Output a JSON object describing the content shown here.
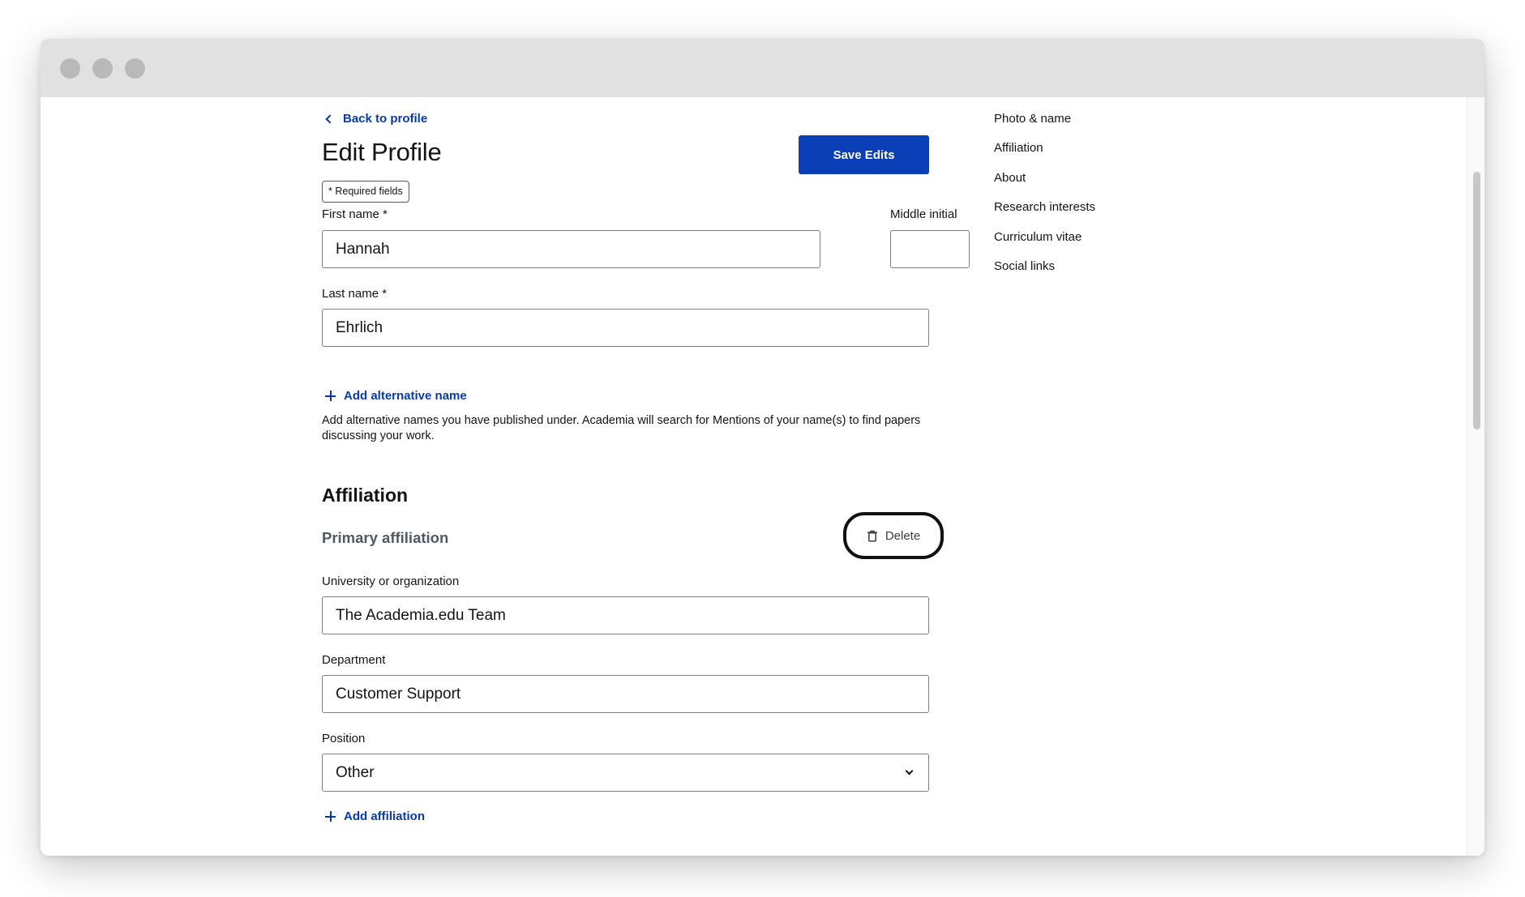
{
  "back_link": {
    "label": "Back to profile"
  },
  "page": {
    "title": "Edit Profile",
    "save_label": "Save Edits",
    "required_note": "* Required fields"
  },
  "name_fields": {
    "first_name": {
      "label": "First name *",
      "value": "Hannah"
    },
    "middle_initial": {
      "label": "Middle initial",
      "value": ""
    },
    "last_name": {
      "label": "Last name *",
      "value": "Ehrlich"
    }
  },
  "alternative_name": {
    "add_label": "Add alternative name",
    "help_text": "Add alternative names you have published under. Academia will search for Mentions of your name(s) to find papers discussing your work."
  },
  "affiliation": {
    "section_title": "Affiliation",
    "primary_label": "Primary affiliation",
    "delete_label": "Delete",
    "university": {
      "label": "University or organization",
      "value": "The Academia.edu Team"
    },
    "department": {
      "label": "Department",
      "value": "Customer Support"
    },
    "position": {
      "label": "Position",
      "value": "Other"
    },
    "add_label": "Add affiliation"
  },
  "side_nav": {
    "items": [
      {
        "label": "Photo & name"
      },
      {
        "label": "Affiliation"
      },
      {
        "label": "About"
      },
      {
        "label": "Research interests"
      },
      {
        "label": "Curriculum vitae"
      },
      {
        "label": "Social links"
      }
    ]
  },
  "icons": {
    "back": "chevron-left-icon",
    "add": "plus-icon",
    "delete": "trash-icon",
    "select": "chevron-down-icon"
  },
  "colors": {
    "accent": "#0b3fb8",
    "link": "#0a3aa8",
    "titlebar": "#e1e1e1",
    "subtle_heading": "#4f5a66"
  }
}
